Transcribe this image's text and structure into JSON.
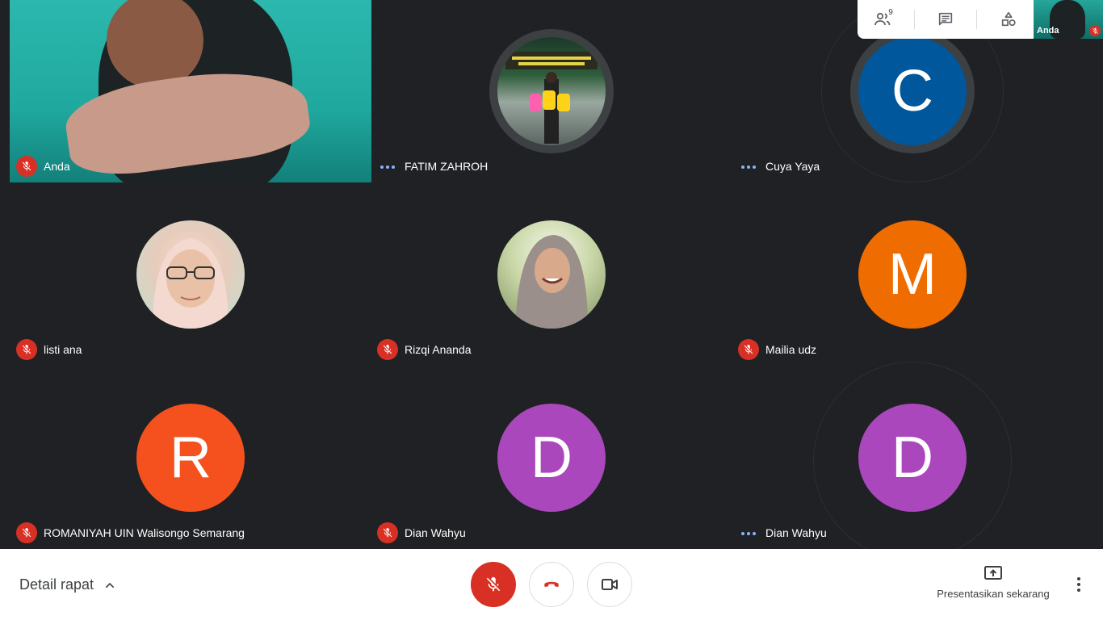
{
  "top_panel": {
    "participants_count": "9"
  },
  "self_thumb": {
    "label": "Anda"
  },
  "tiles": [
    {
      "name": "Anda",
      "status": "muted"
    },
    {
      "name": "FATIM ZAHROH",
      "status": "speaking"
    },
    {
      "name": "Cuya Yaya",
      "status": "speaking",
      "initial": "C",
      "color": "#01579b"
    },
    {
      "name": "listi ana",
      "status": "muted"
    },
    {
      "name": "Rizqi Ananda",
      "status": "muted"
    },
    {
      "name": "Mailia udz",
      "status": "muted",
      "initial": "M",
      "color": "#ef6c00"
    },
    {
      "name": "ROMANIYAH UIN Walisongo Semarang",
      "status": "muted",
      "initial": "R",
      "color": "#f4511e"
    },
    {
      "name": "Dian Wahyu",
      "status": "muted",
      "initial": "D",
      "color": "#ab47bc"
    },
    {
      "name": "Dian Wahyu",
      "status": "speaking",
      "initial": "D",
      "color": "#ab47bc"
    }
  ],
  "bottom": {
    "details_label": "Detail rapat",
    "present_label": "Presentasikan sekarang"
  },
  "colors": {
    "mic_off_red": "#d93025",
    "speaking_dots": "#8ab4f8",
    "background": "#202124"
  }
}
